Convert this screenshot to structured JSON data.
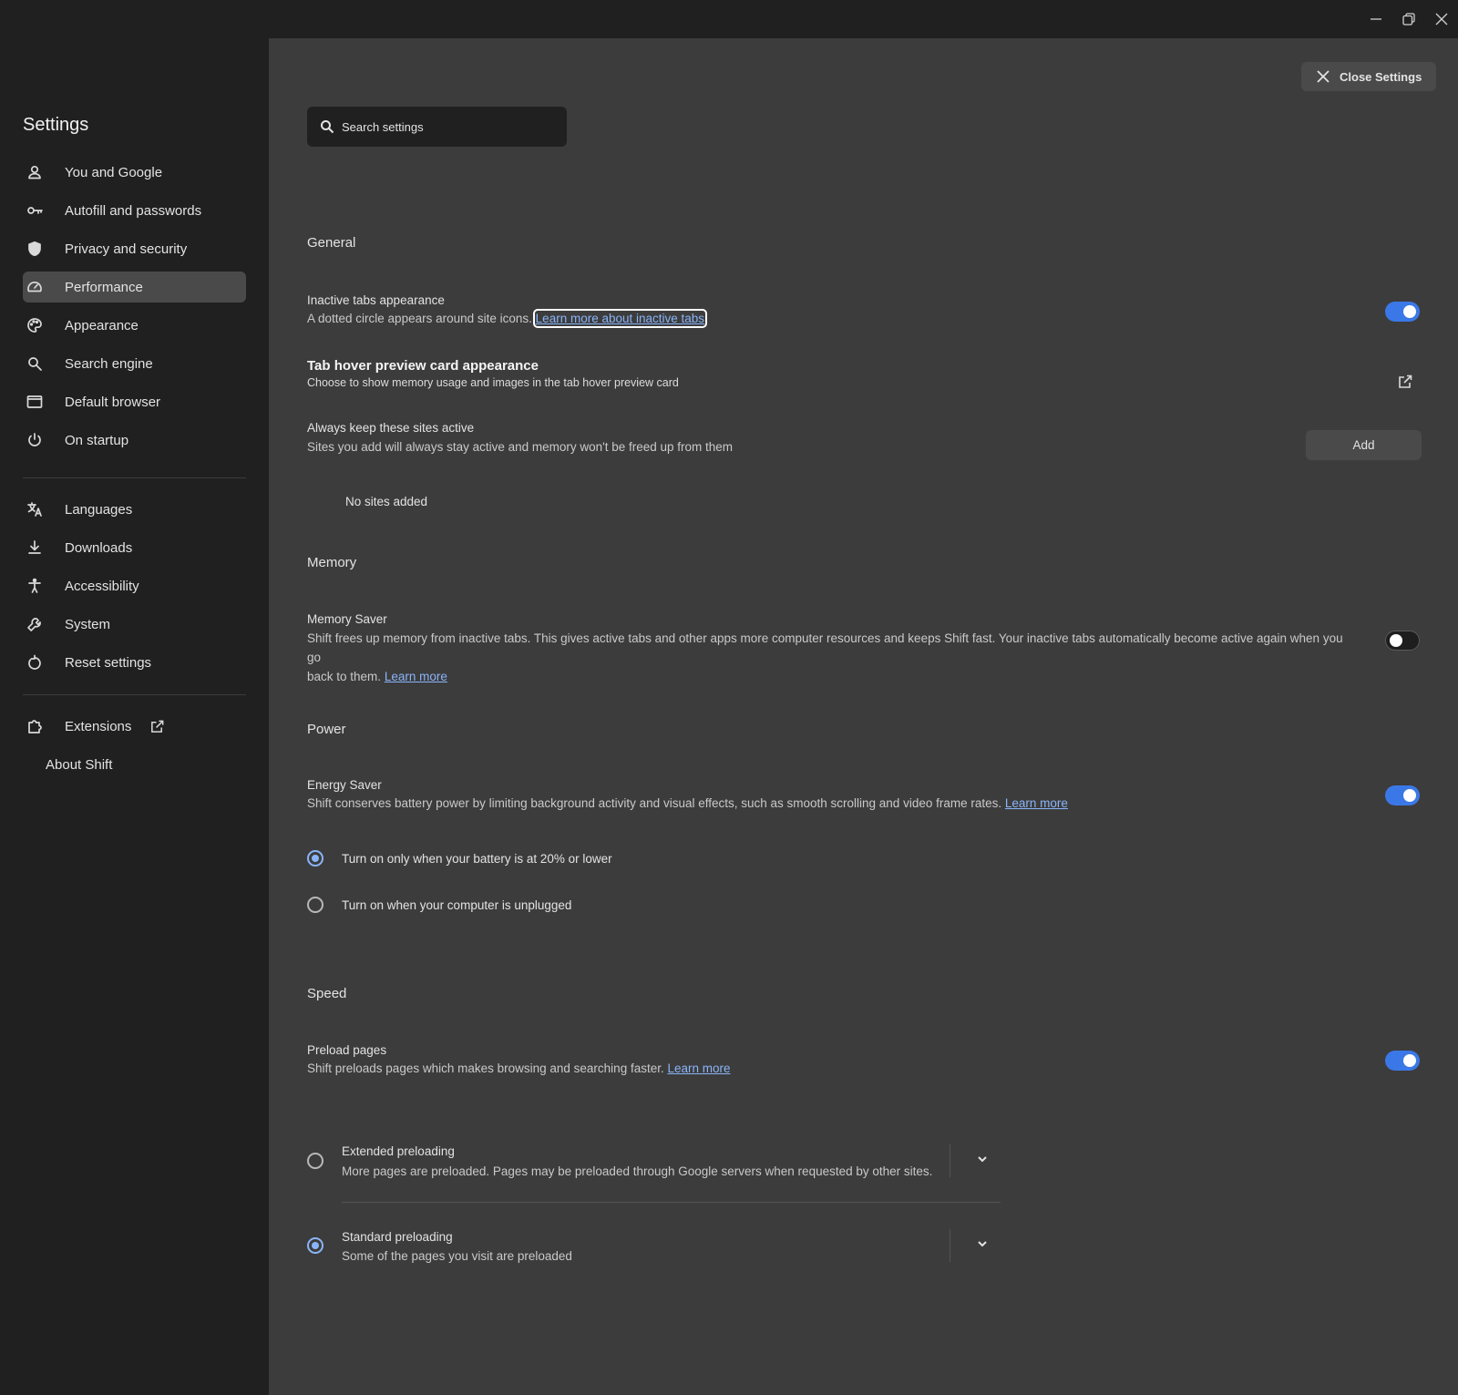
{
  "window": {
    "controls": [
      "minimize-icon",
      "restore-icon",
      "close-icon"
    ]
  },
  "sidebar": {
    "title": "Settings",
    "items": [
      {
        "label": "You and Google",
        "icon": "person-icon"
      },
      {
        "label": "Autofill and passwords",
        "icon": "key-icon"
      },
      {
        "label": "Privacy and security",
        "icon": "shield-icon"
      },
      {
        "label": "Performance",
        "icon": "speedometer-icon",
        "active": true
      },
      {
        "label": "Appearance",
        "icon": "palette-icon"
      },
      {
        "label": "Search engine",
        "icon": "search-icon"
      },
      {
        "label": "Default browser",
        "icon": "browser-icon"
      },
      {
        "label": "On startup",
        "icon": "power-icon"
      },
      {
        "label": "Languages",
        "icon": "translate-icon"
      },
      {
        "label": "Downloads",
        "icon": "download-icon"
      },
      {
        "label": "Accessibility",
        "icon": "accessibility-icon"
      },
      {
        "label": "System",
        "icon": "wrench-icon"
      },
      {
        "label": "Reset settings",
        "icon": "reset-icon"
      },
      {
        "label": "Extensions",
        "icon": "puzzle-icon"
      },
      {
        "label": "About Shift"
      }
    ]
  },
  "header": {
    "close_label": "Close Settings",
    "search_placeholder": "Search settings"
  },
  "general": {
    "title": "General",
    "inactive_tabs": {
      "title": "Inactive tabs appearance",
      "desc": "A dotted circle appears around site icons.",
      "link": "Learn more about inactive tabs",
      "enabled": true
    },
    "hover_card": {
      "title": "Tab hover preview card appearance",
      "desc": "Choose to show memory usage and images in the tab hover preview card"
    },
    "keep_active": {
      "title": "Always keep these sites active",
      "desc": "Sites you add will always stay active and memory won't be freed up from them",
      "add_label": "Add",
      "empty_label": "No sites added"
    }
  },
  "memory": {
    "title": "Memory",
    "saver": {
      "title": "Memory Saver",
      "desc_line1": "Shift frees up memory from inactive tabs. This gives active tabs and other apps more computer resources and keeps Shift fast. Your inactive tabs automatically become active again when you go",
      "desc_line2": "back to them.",
      "link": "Learn more",
      "enabled": false
    }
  },
  "power": {
    "title": "Power",
    "saver": {
      "title": "Energy Saver",
      "desc": "Shift conserves battery power by limiting background activity and visual effects, such as smooth scrolling and video frame rates.",
      "link": "Learn more",
      "enabled": true
    },
    "options": [
      {
        "label": "Turn on only when your battery is at 20% or lower",
        "checked": true
      },
      {
        "label": "Turn on when your computer is unplugged",
        "checked": false
      }
    ]
  },
  "speed": {
    "title": "Speed",
    "preload": {
      "title": "Preload pages",
      "desc": "Shift preloads pages which makes browsing and searching faster.",
      "link": "Learn more",
      "enabled": true
    },
    "options": [
      {
        "label": "Extended preloading",
        "desc": "More pages are preloaded. Pages may be preloaded through Google servers when requested by other sites.",
        "checked": false
      },
      {
        "label": "Standard preloading",
        "desc": "Some of the pages you visit are preloaded",
        "checked": true
      }
    ]
  }
}
